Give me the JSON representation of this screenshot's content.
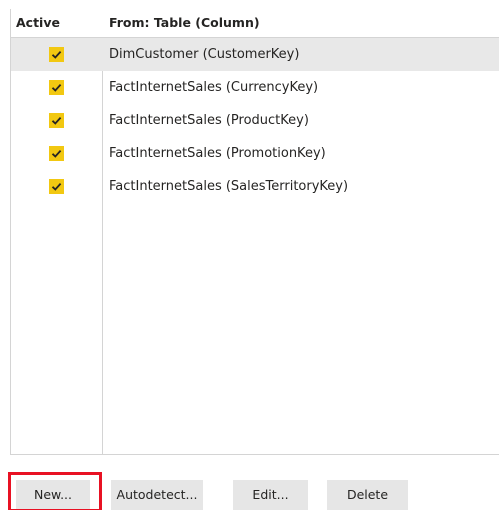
{
  "table": {
    "headers": {
      "active": "Active",
      "from": "From: Table (Column)"
    },
    "rows": [
      {
        "label": "DimCustomer (CustomerKey)",
        "active": true,
        "selected": true
      },
      {
        "label": "FactInternetSales (CurrencyKey)",
        "active": true,
        "selected": false
      },
      {
        "label": "FactInternetSales (ProductKey)",
        "active": true,
        "selected": false
      },
      {
        "label": "FactInternetSales (PromotionKey)",
        "active": true,
        "selected": false
      },
      {
        "label": "FactInternetSales (SalesTerritoryKey)",
        "active": true,
        "selected": false
      }
    ]
  },
  "buttons": {
    "new": "New...",
    "autodetect": "Autodetect...",
    "edit": "Edit...",
    "delete": "Delete"
  },
  "colors": {
    "checkbox": "#f2c811",
    "selected_row": "#e8e8e8",
    "button": "#e6e6e6",
    "highlight": "#e81123"
  }
}
